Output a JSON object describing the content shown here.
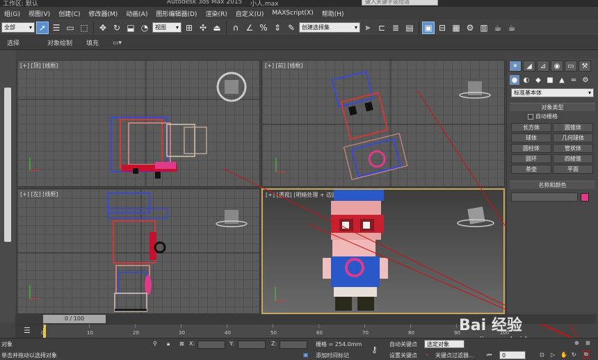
{
  "window": {
    "project": "工作区: 默认",
    "app_title": "Autodesk 3ds Max  2015",
    "file": "小人.max",
    "search_placeholder": "键入关键字或短语"
  },
  "menu": [
    "组(G)",
    "视图(V)",
    "创建(C)",
    "修改器(M)",
    "动画(A)",
    "图形编辑器(D)",
    "渲染(R)",
    "自定义(U)",
    "MAXScript(X)",
    "帮助(H)"
  ],
  "toolbar": {
    "selection_filter": "全部",
    "reference_coord": "视图",
    "named_selection": "创建选择集"
  },
  "ribbon_tabs": [
    "选择",
    "对象绘制",
    "填充"
  ],
  "viewports": {
    "top": "[+] [顶] [线框]",
    "front": "[+] [前] [线框]",
    "left": "[+] [左] [线框]",
    "perspective": "[+] [透视] [明暗处理 + 边面]"
  },
  "command_panel": {
    "category": "标准基本体",
    "object_type_title": "对象类型",
    "autogrid": "自动栅格",
    "primitives": [
      "长方体",
      "圆锥体",
      "球体",
      "几何球体",
      "圆柱体",
      "管状体",
      "圆环",
      "四棱锥",
      "茶壶",
      "平面"
    ],
    "name_color_title": "名称和颜色",
    "object_color": "#e03b8b"
  },
  "timeline": {
    "frame_label": "0 / 100",
    "ticks": [
      "0",
      "10",
      "20",
      "30",
      "40",
      "50",
      "60",
      "70",
      "80",
      "90",
      "100"
    ]
  },
  "status": {
    "selection": "对象",
    "prompt": "单击并拖动以选择对象",
    "x_label": "X:",
    "y_label": "Y:",
    "z_label": "Z:",
    "grid": "栅格 = 254.0mm",
    "add_time_tag": "添加时间标记",
    "auto_key": "自动关键点",
    "set_key": "设置关键点",
    "selected_object": "选定对象",
    "key_filters": "关键点过滤器...",
    "frame": "0"
  },
  "watermark": {
    "brand": "Bai 经验",
    "url": "jingyan.baidu.com"
  }
}
